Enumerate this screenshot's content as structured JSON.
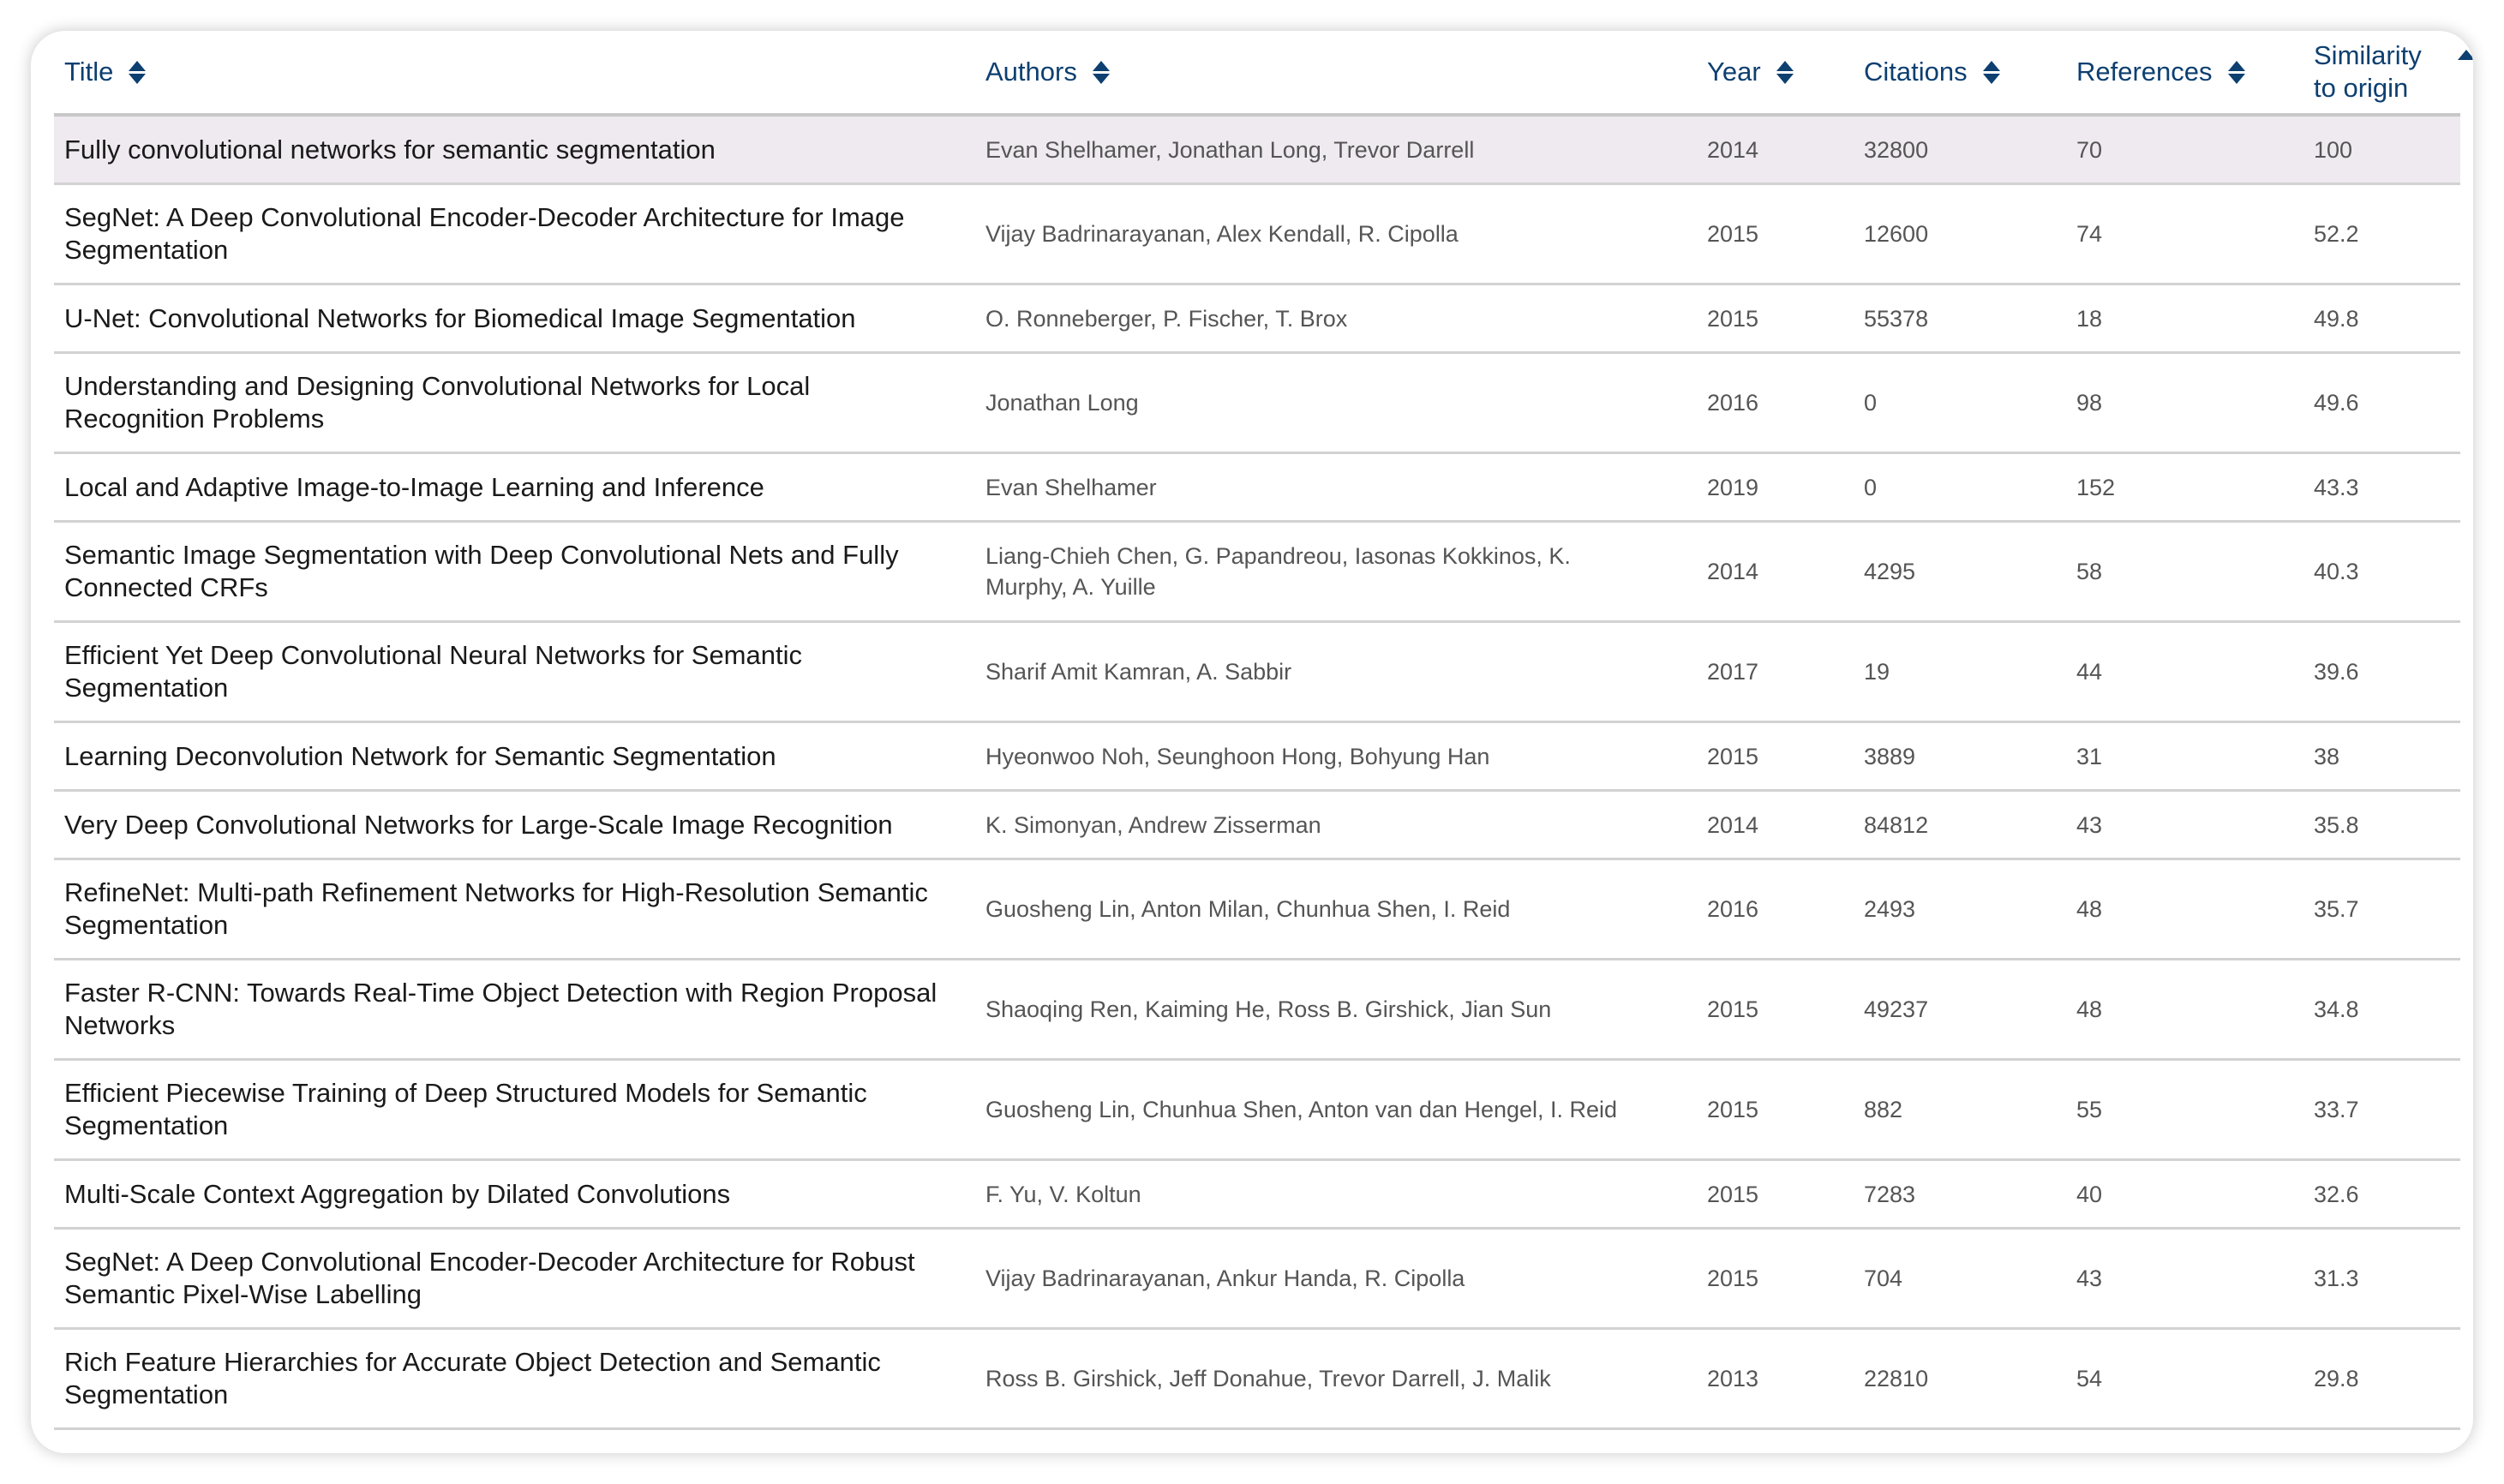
{
  "columns": [
    {
      "label": "Title",
      "sort": "none"
    },
    {
      "label": "Authors",
      "sort": "none"
    },
    {
      "label": "Year",
      "sort": "none"
    },
    {
      "label": "Citations",
      "sort": "none"
    },
    {
      "label": "References",
      "sort": "none"
    },
    {
      "label": "Similarity to origin",
      "sort": "ascending"
    }
  ],
  "colors": {
    "header": "#0d3f70",
    "highlight_row": "#efe9f0"
  },
  "rows": [
    {
      "title": "Fully convolutional networks for semantic segmentation",
      "authors": "Evan Shelhamer, Jonathan Long, Trevor Darrell",
      "year": "2014",
      "citations": "32800",
      "references": "70",
      "similarity": "100",
      "highlighted": true
    },
    {
      "title": "SegNet: A Deep Convolutional Encoder-Decoder Architecture for Image Segmentation",
      "authors": "Vijay Badrinarayanan, Alex Kendall, R. Cipolla",
      "year": "2015",
      "citations": "12600",
      "references": "74",
      "similarity": "52.2"
    },
    {
      "title": "U-Net: Convolutional Networks for Biomedical Image Segmentation",
      "authors": "O. Ronneberger, P. Fischer, T. Brox",
      "year": "2015",
      "citations": "55378",
      "references": "18",
      "similarity": "49.8"
    },
    {
      "title": "Understanding and Designing Convolutional Networks for Local Recognition Problems",
      "authors": "Jonathan Long",
      "year": "2016",
      "citations": "0",
      "references": "98",
      "similarity": "49.6"
    },
    {
      "title": "Local and Adaptive Image-to-Image Learning and Inference",
      "authors": "Evan Shelhamer",
      "year": "2019",
      "citations": "0",
      "references": "152",
      "similarity": "43.3"
    },
    {
      "title": "Semantic Image Segmentation with Deep Convolutional Nets and Fully Connected CRFs",
      "authors": "Liang-Chieh Chen, G. Papandreou, Iasonas Kokkinos, K. Murphy, A. Yuille",
      "year": "2014",
      "citations": "4295",
      "references": "58",
      "similarity": "40.3"
    },
    {
      "title": "Efficient Yet Deep Convolutional Neural Networks for Semantic Segmentation",
      "authors": "Sharif Amit Kamran, A. Sabbir",
      "year": "2017",
      "citations": "19",
      "references": "44",
      "similarity": "39.6"
    },
    {
      "title": "Learning Deconvolution Network for Semantic Segmentation",
      "authors": "Hyeonwoo Noh, Seunghoon Hong, Bohyung Han",
      "year": "2015",
      "citations": "3889",
      "references": "31",
      "similarity": "38"
    },
    {
      "title": "Very Deep Convolutional Networks for Large-Scale Image Recognition",
      "authors": "K. Simonyan, Andrew Zisserman",
      "year": "2014",
      "citations": "84812",
      "references": "43",
      "similarity": "35.8"
    },
    {
      "title": "RefineNet: Multi-path Refinement Networks for High-Resolution Semantic Segmentation",
      "authors": "Guosheng Lin, Anton Milan, Chunhua Shen, I. Reid",
      "year": "2016",
      "citations": "2493",
      "references": "48",
      "similarity": "35.7"
    },
    {
      "title": "Faster R-CNN: Towards Real-Time Object Detection with Region Proposal Networks",
      "authors": "Shaoqing Ren, Kaiming He, Ross B. Girshick, Jian Sun",
      "year": "2015",
      "citations": "49237",
      "references": "48",
      "similarity": "34.8"
    },
    {
      "title": "Efficient Piecewise Training of Deep Structured Models for Semantic Segmentation",
      "authors": "Guosheng Lin, Chunhua Shen, Anton van dan Hengel, I. Reid",
      "year": "2015",
      "citations": "882",
      "references": "55",
      "similarity": "33.7"
    },
    {
      "title": "Multi-Scale Context Aggregation by Dilated Convolutions",
      "authors": "F. Yu, V. Koltun",
      "year": "2015",
      "citations": "7283",
      "references": "40",
      "similarity": "32.6"
    },
    {
      "title": "SegNet: A Deep Convolutional Encoder-Decoder Architecture for Robust Semantic Pixel-Wise Labelling",
      "authors": "Vijay Badrinarayanan, Ankur Handa, R. Cipolla",
      "year": "2015",
      "citations": "704",
      "references": "43",
      "similarity": "31.3"
    },
    {
      "title": "Rich Feature Hierarchies for Accurate Object Detection and Semantic Segmentation",
      "authors": "Ross B. Girshick, Jeff Donahue, Trevor Darrell, J. Malik",
      "year": "2013",
      "citations": "22810",
      "references": "54",
      "similarity": "29.8"
    }
  ]
}
